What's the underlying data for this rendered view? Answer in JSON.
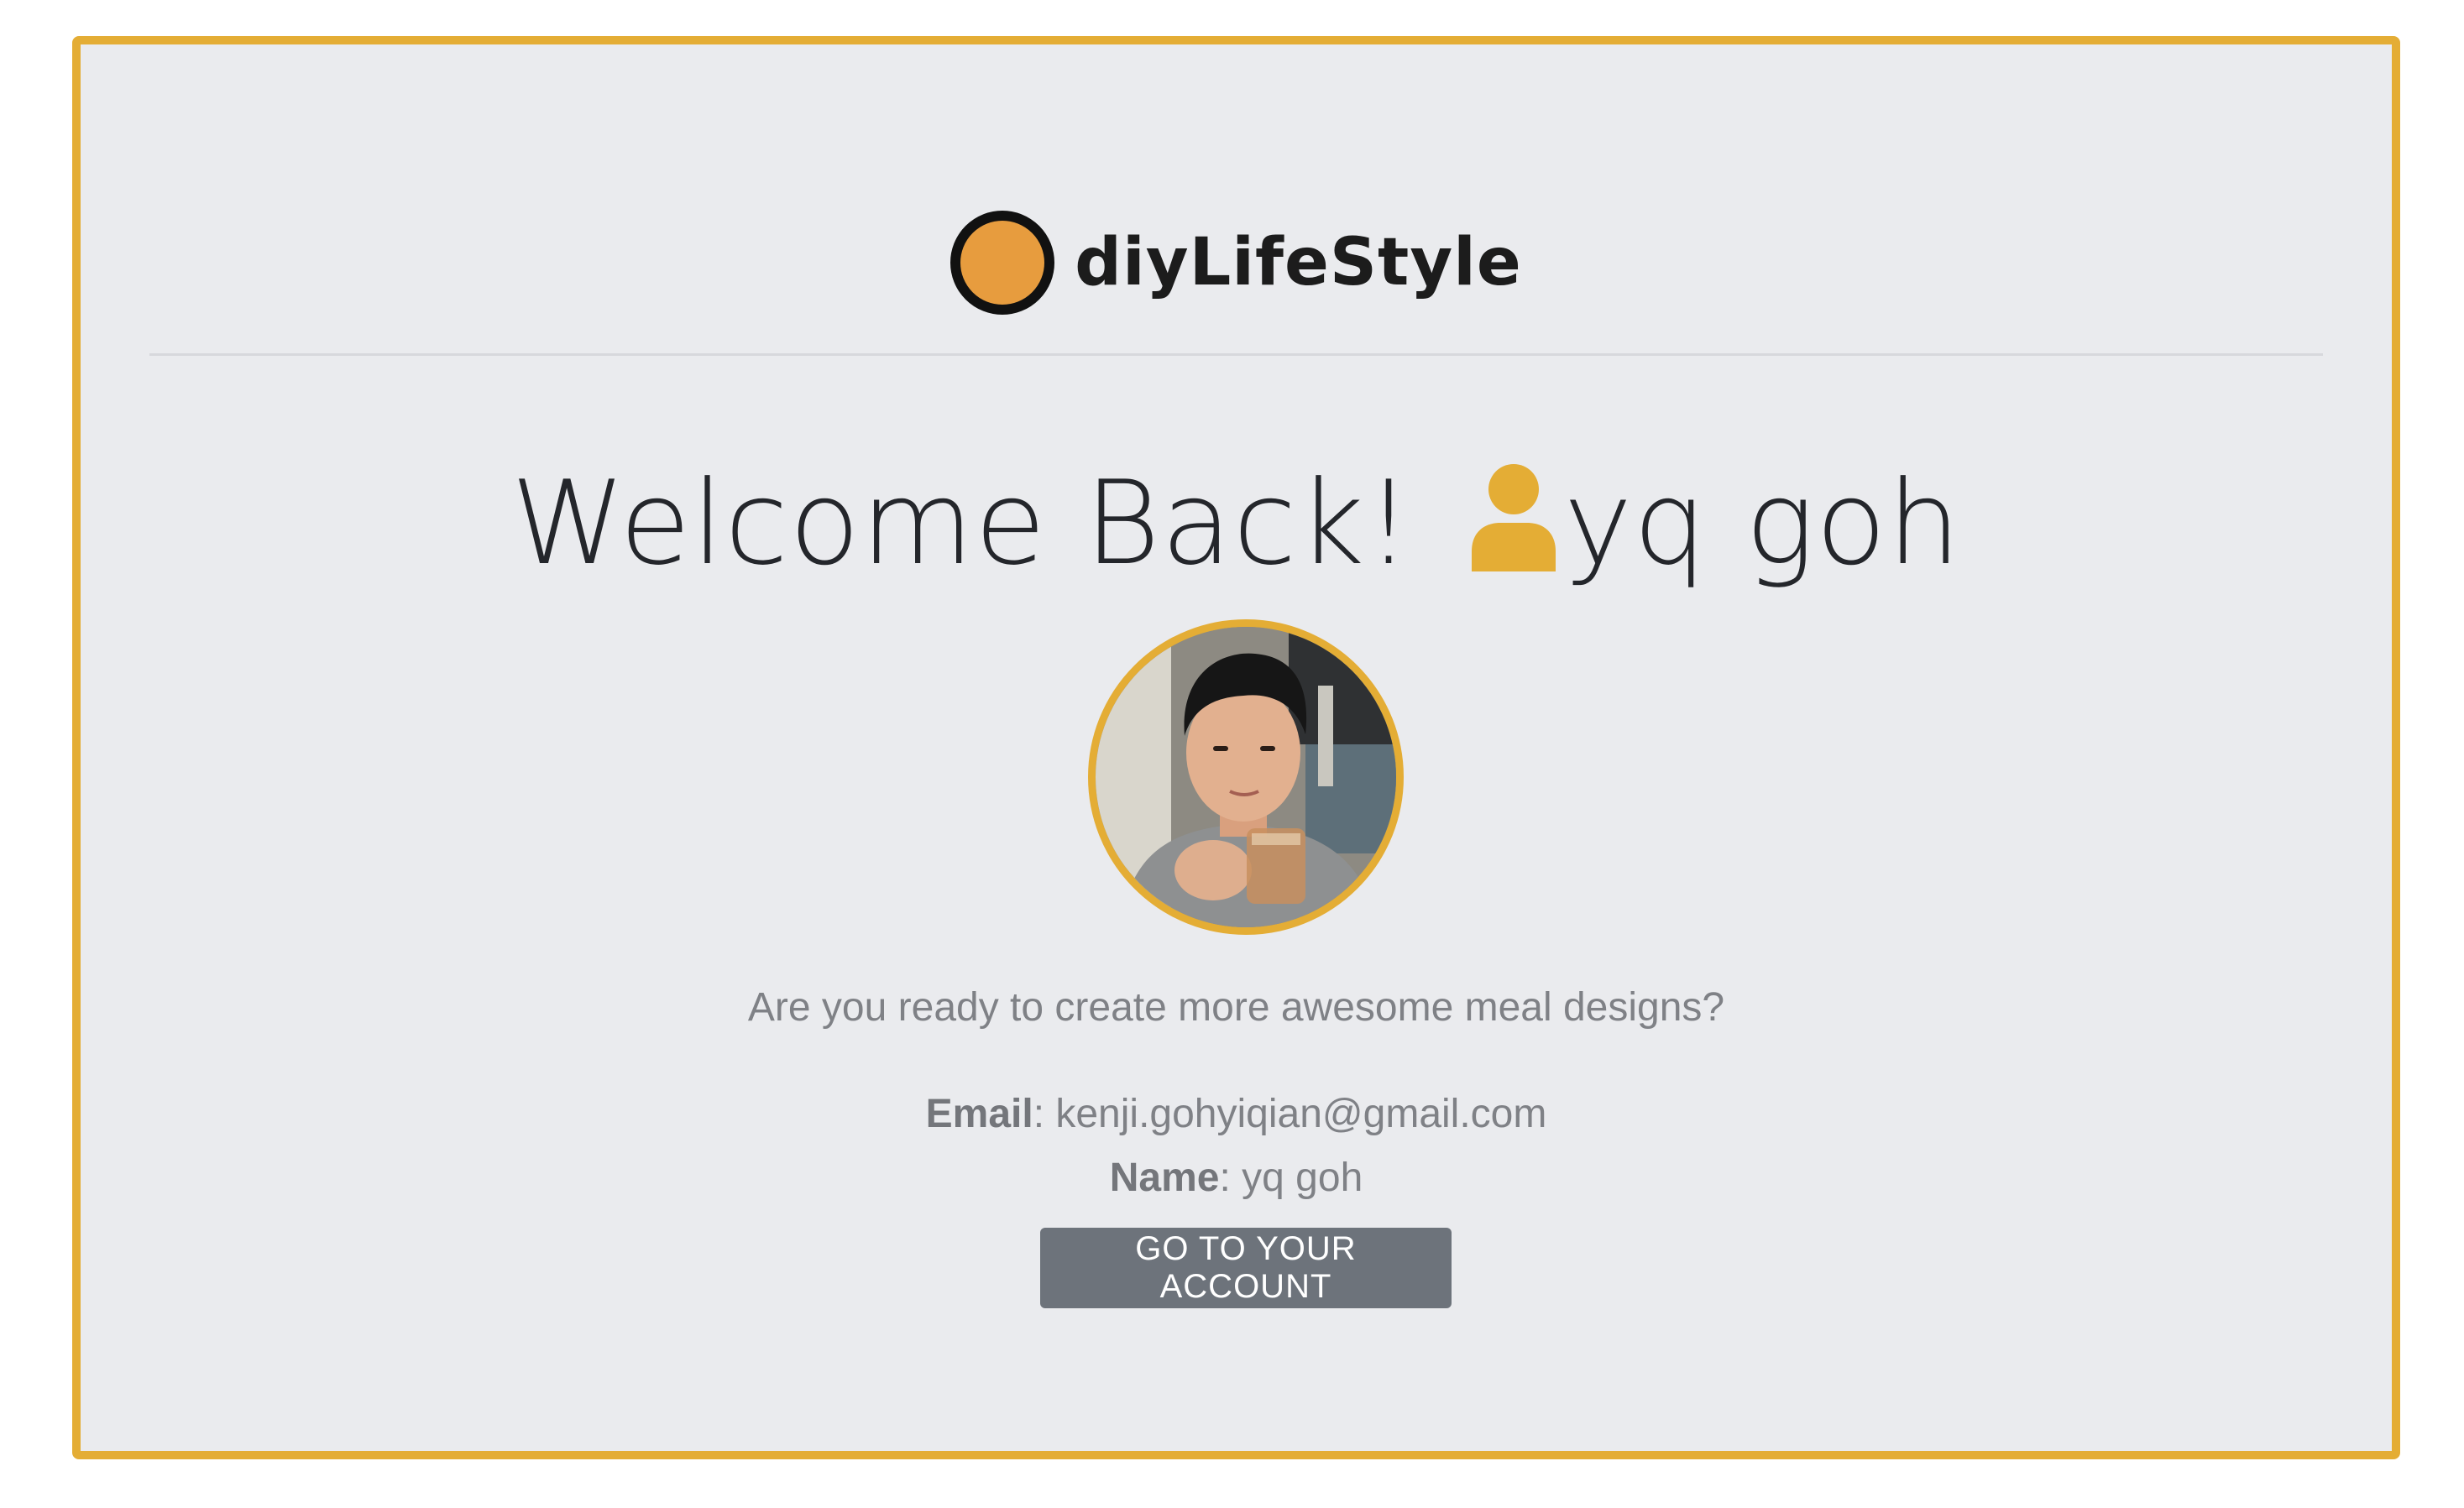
{
  "brand": {
    "name": "diyLifeStyle",
    "logo_icon": "circle-logo-icon",
    "logo_color": "#e79c3e"
  },
  "welcome": {
    "greeting": "Welcome Back!",
    "user_icon": "user-icon",
    "username": "yq goh"
  },
  "profile": {
    "avatar": "profile-photo",
    "tagline": "Are you ready to create more awesome meal designs?",
    "email_label": "Email",
    "email_value": ": kenji.gohyiqian@gmail.com",
    "name_label": "Name",
    "name_value": ": yq goh"
  },
  "actions": {
    "account_button": "GO TO YOUR ACCOUNT"
  },
  "colors": {
    "accent": "#e4ad35",
    "background": "#eaebee",
    "button": "#6d737b"
  }
}
